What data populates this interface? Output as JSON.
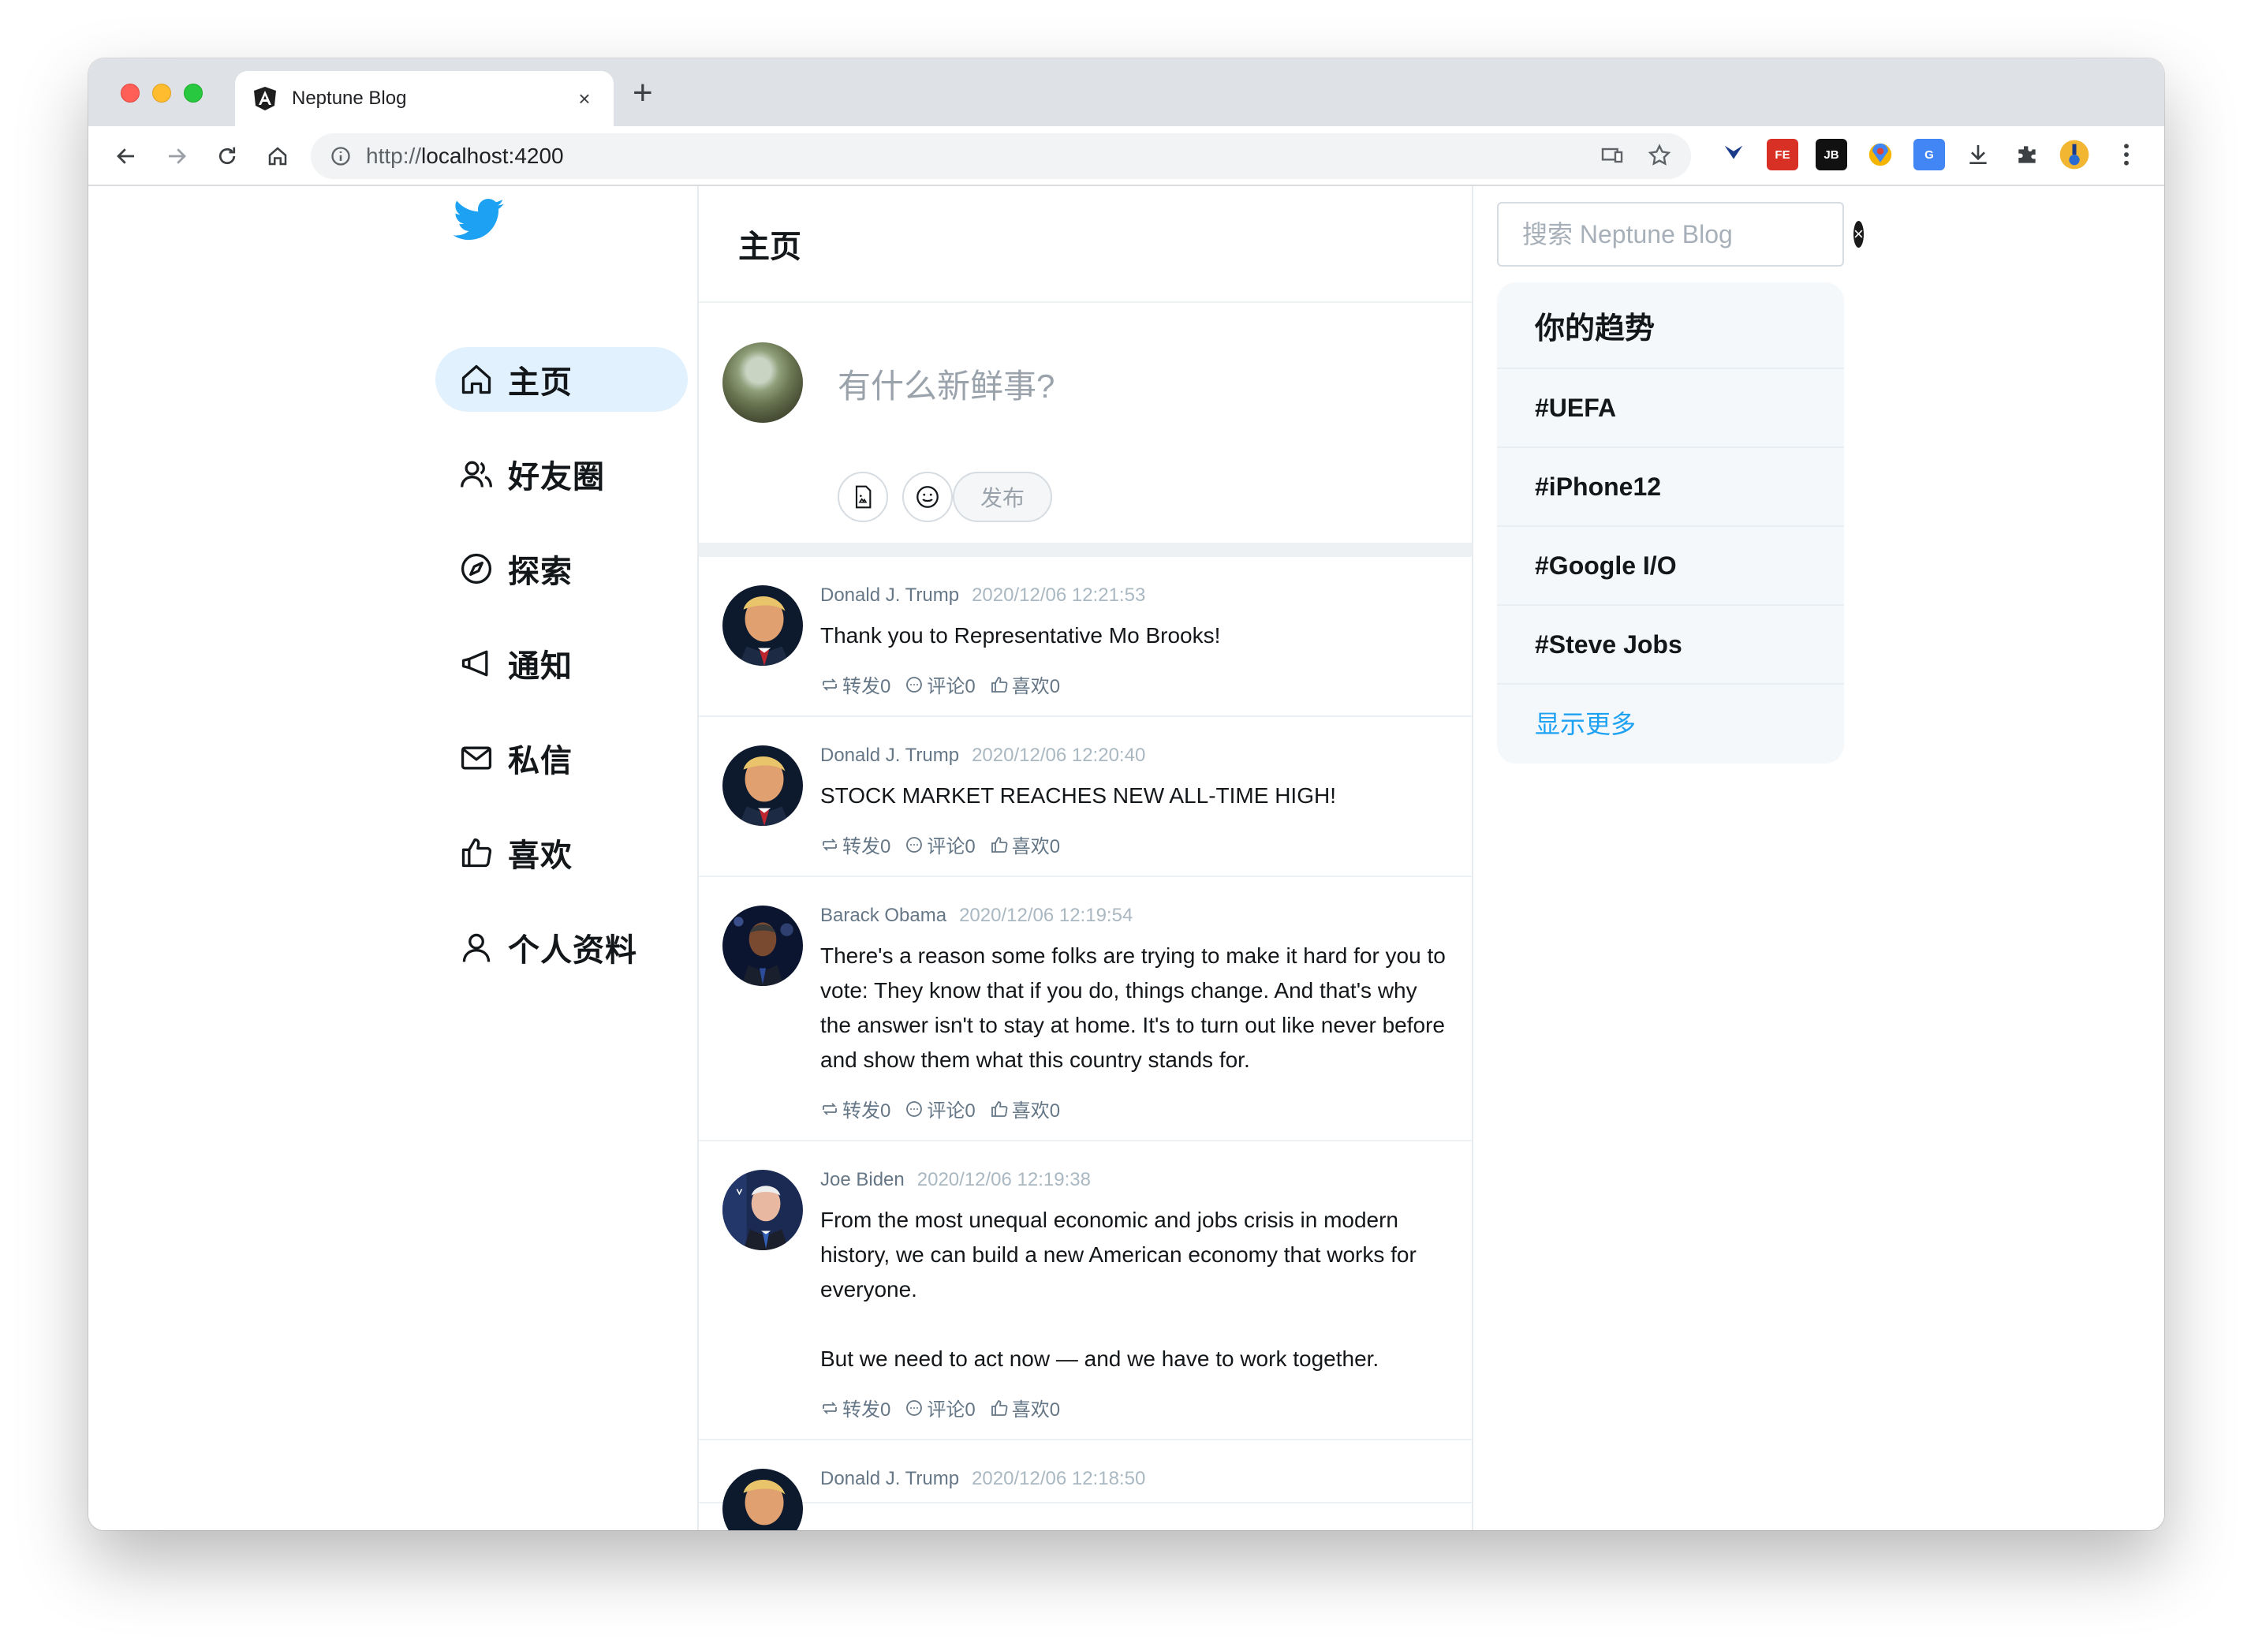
{
  "browser": {
    "tab_title": "Neptune Blog",
    "tab_close": "×",
    "new_tab": "+",
    "url_protocol": "http://",
    "url_host": "localhost:4200",
    "extensions": [
      "Y",
      "FE",
      "JB",
      "",
      "G"
    ]
  },
  "nav": {
    "items": [
      {
        "label": "主页",
        "icon": "home-icon",
        "active": true
      },
      {
        "label": "好友圈",
        "icon": "friends-icon"
      },
      {
        "label": "探索",
        "icon": "compass-icon"
      },
      {
        "label": "通知",
        "icon": "megaphone-icon"
      },
      {
        "label": "私信",
        "icon": "mail-icon"
      },
      {
        "label": "喜欢",
        "icon": "thumbs-up-icon"
      },
      {
        "label": "个人资料",
        "icon": "user-icon"
      }
    ]
  },
  "main": {
    "title": "主页",
    "composer": {
      "placeholder": "有什么新鲜事?",
      "publish": "发布"
    },
    "posts": [
      {
        "author": "Donald J. Trump",
        "time": "2020/12/06 12:21:53",
        "text": "Thank you to Representative Mo Brooks!",
        "retweet": "转发0",
        "comment": "评论0",
        "like": "喜欢0"
      },
      {
        "author": "Donald J. Trump",
        "time": "2020/12/06 12:20:40",
        "text": "STOCK MARKET REACHES NEW ALL-TIME HIGH!",
        "retweet": "转发0",
        "comment": "评论0",
        "like": "喜欢0"
      },
      {
        "author": "Barack Obama",
        "time": "2020/12/06 12:19:54",
        "text": "There's a reason some folks are trying to make it hard for you to vote: They know that if you do, things change. And that's why the answer isn't to stay at home. It's to turn out like never before and show them what this country stands for.",
        "retweet": "转发0",
        "comment": "评论0",
        "like": "喜欢0"
      },
      {
        "author": "Joe Biden",
        "time": "2020/12/06 12:19:38",
        "text": "From the most unequal economic and jobs crisis in modern history, we can build a new American economy that works for everyone.\n\nBut we need to act now — and we have to work together.",
        "retweet": "转发0",
        "comment": "评论0",
        "like": "喜欢0"
      },
      {
        "author": "Donald J. Trump",
        "time": "2020/12/06 12:18:50",
        "text": "",
        "retweet": "",
        "comment": "",
        "like": ""
      }
    ]
  },
  "search": {
    "placeholder": "搜索 Neptune Blog",
    "clear": "×"
  },
  "trends": {
    "title": "你的趋势",
    "items": [
      "#UEFA",
      "#iPhone12",
      "#Google I/O",
      "#Steve Jobs"
    ],
    "more": "显示更多"
  },
  "colors": {
    "accent": "#1da1f2",
    "active_nav_bg": "#e1f1fd",
    "muted_text": "#657786",
    "time_text": "#aab8c2"
  }
}
